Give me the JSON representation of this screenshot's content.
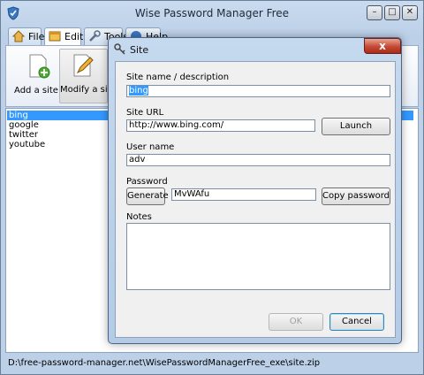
{
  "window": {
    "title": "Wise Password Manager Free"
  },
  "menu_tabs": [
    {
      "label": "File"
    },
    {
      "label": "Edit"
    },
    {
      "label": "Tools"
    },
    {
      "label": "Help"
    }
  ],
  "ribbon": {
    "add_label": "Add a site",
    "modify_label": "Modify a site"
  },
  "sites": [
    "bing",
    "google",
    "twitter",
    "youtube"
  ],
  "status": {
    "path": "D:\\free-password-manager.net\\WisePasswordManagerFree_exe\\site.zip"
  },
  "dialog": {
    "title": "Site",
    "close": "x",
    "site_name_label": "Site name / description",
    "site_name_value": "bing",
    "site_url_label": "Site URL",
    "site_url_value": "http://www.bing.com/",
    "launch_label": "Launch",
    "username_label": "User name",
    "username_value": "adv",
    "password_label": "Password",
    "generate_label": "Generate",
    "password_value": "MvWAfu",
    "copy_password_label": "Copy password",
    "notes_label": "Notes",
    "ok_label": "OK",
    "cancel_label": "Cancel"
  }
}
